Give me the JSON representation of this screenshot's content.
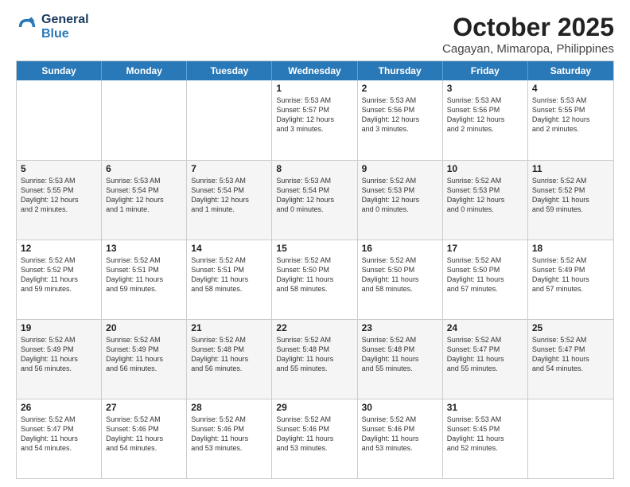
{
  "logo": {
    "line1": "General",
    "line2": "Blue"
  },
  "title": "October 2025",
  "subtitle": "Cagayan, Mimaropa, Philippines",
  "weekdays": [
    "Sunday",
    "Monday",
    "Tuesday",
    "Wednesday",
    "Thursday",
    "Friday",
    "Saturday"
  ],
  "weeks": [
    [
      {
        "day": "",
        "info": "",
        "shaded": false
      },
      {
        "day": "",
        "info": "",
        "shaded": false
      },
      {
        "day": "",
        "info": "",
        "shaded": false
      },
      {
        "day": "1",
        "info": "Sunrise: 5:53 AM\nSunset: 5:57 PM\nDaylight: 12 hours\nand 3 minutes.",
        "shaded": false
      },
      {
        "day": "2",
        "info": "Sunrise: 5:53 AM\nSunset: 5:56 PM\nDaylight: 12 hours\nand 3 minutes.",
        "shaded": false
      },
      {
        "day": "3",
        "info": "Sunrise: 5:53 AM\nSunset: 5:56 PM\nDaylight: 12 hours\nand 2 minutes.",
        "shaded": false
      },
      {
        "day": "4",
        "info": "Sunrise: 5:53 AM\nSunset: 5:55 PM\nDaylight: 12 hours\nand 2 minutes.",
        "shaded": false
      }
    ],
    [
      {
        "day": "5",
        "info": "Sunrise: 5:53 AM\nSunset: 5:55 PM\nDaylight: 12 hours\nand 2 minutes.",
        "shaded": true
      },
      {
        "day": "6",
        "info": "Sunrise: 5:53 AM\nSunset: 5:54 PM\nDaylight: 12 hours\nand 1 minute.",
        "shaded": true
      },
      {
        "day": "7",
        "info": "Sunrise: 5:53 AM\nSunset: 5:54 PM\nDaylight: 12 hours\nand 1 minute.",
        "shaded": true
      },
      {
        "day": "8",
        "info": "Sunrise: 5:53 AM\nSunset: 5:54 PM\nDaylight: 12 hours\nand 0 minutes.",
        "shaded": true
      },
      {
        "day": "9",
        "info": "Sunrise: 5:52 AM\nSunset: 5:53 PM\nDaylight: 12 hours\nand 0 minutes.",
        "shaded": true
      },
      {
        "day": "10",
        "info": "Sunrise: 5:52 AM\nSunset: 5:53 PM\nDaylight: 12 hours\nand 0 minutes.",
        "shaded": true
      },
      {
        "day": "11",
        "info": "Sunrise: 5:52 AM\nSunset: 5:52 PM\nDaylight: 11 hours\nand 59 minutes.",
        "shaded": true
      }
    ],
    [
      {
        "day": "12",
        "info": "Sunrise: 5:52 AM\nSunset: 5:52 PM\nDaylight: 11 hours\nand 59 minutes.",
        "shaded": false
      },
      {
        "day": "13",
        "info": "Sunrise: 5:52 AM\nSunset: 5:51 PM\nDaylight: 11 hours\nand 59 minutes.",
        "shaded": false
      },
      {
        "day": "14",
        "info": "Sunrise: 5:52 AM\nSunset: 5:51 PM\nDaylight: 11 hours\nand 58 minutes.",
        "shaded": false
      },
      {
        "day": "15",
        "info": "Sunrise: 5:52 AM\nSunset: 5:50 PM\nDaylight: 11 hours\nand 58 minutes.",
        "shaded": false
      },
      {
        "day": "16",
        "info": "Sunrise: 5:52 AM\nSunset: 5:50 PM\nDaylight: 11 hours\nand 58 minutes.",
        "shaded": false
      },
      {
        "day": "17",
        "info": "Sunrise: 5:52 AM\nSunset: 5:50 PM\nDaylight: 11 hours\nand 57 minutes.",
        "shaded": false
      },
      {
        "day": "18",
        "info": "Sunrise: 5:52 AM\nSunset: 5:49 PM\nDaylight: 11 hours\nand 57 minutes.",
        "shaded": false
      }
    ],
    [
      {
        "day": "19",
        "info": "Sunrise: 5:52 AM\nSunset: 5:49 PM\nDaylight: 11 hours\nand 56 minutes.",
        "shaded": true
      },
      {
        "day": "20",
        "info": "Sunrise: 5:52 AM\nSunset: 5:49 PM\nDaylight: 11 hours\nand 56 minutes.",
        "shaded": true
      },
      {
        "day": "21",
        "info": "Sunrise: 5:52 AM\nSunset: 5:48 PM\nDaylight: 11 hours\nand 56 minutes.",
        "shaded": true
      },
      {
        "day": "22",
        "info": "Sunrise: 5:52 AM\nSunset: 5:48 PM\nDaylight: 11 hours\nand 55 minutes.",
        "shaded": true
      },
      {
        "day": "23",
        "info": "Sunrise: 5:52 AM\nSunset: 5:48 PM\nDaylight: 11 hours\nand 55 minutes.",
        "shaded": true
      },
      {
        "day": "24",
        "info": "Sunrise: 5:52 AM\nSunset: 5:47 PM\nDaylight: 11 hours\nand 55 minutes.",
        "shaded": true
      },
      {
        "day": "25",
        "info": "Sunrise: 5:52 AM\nSunset: 5:47 PM\nDaylight: 11 hours\nand 54 minutes.",
        "shaded": true
      }
    ],
    [
      {
        "day": "26",
        "info": "Sunrise: 5:52 AM\nSunset: 5:47 PM\nDaylight: 11 hours\nand 54 minutes.",
        "shaded": false
      },
      {
        "day": "27",
        "info": "Sunrise: 5:52 AM\nSunset: 5:46 PM\nDaylight: 11 hours\nand 54 minutes.",
        "shaded": false
      },
      {
        "day": "28",
        "info": "Sunrise: 5:52 AM\nSunset: 5:46 PM\nDaylight: 11 hours\nand 53 minutes.",
        "shaded": false
      },
      {
        "day": "29",
        "info": "Sunrise: 5:52 AM\nSunset: 5:46 PM\nDaylight: 11 hours\nand 53 minutes.",
        "shaded": false
      },
      {
        "day": "30",
        "info": "Sunrise: 5:52 AM\nSunset: 5:46 PM\nDaylight: 11 hours\nand 53 minutes.",
        "shaded": false
      },
      {
        "day": "31",
        "info": "Sunrise: 5:53 AM\nSunset: 5:45 PM\nDaylight: 11 hours\nand 52 minutes.",
        "shaded": false
      },
      {
        "day": "",
        "info": "",
        "shaded": false
      }
    ]
  ]
}
